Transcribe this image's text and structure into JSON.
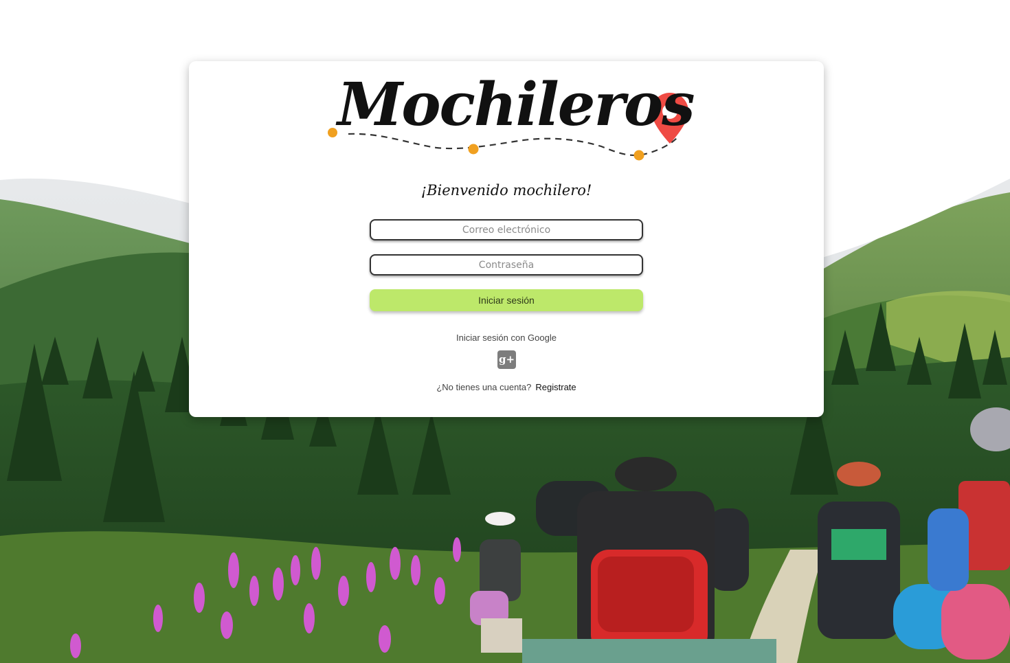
{
  "brand": {
    "name": "Mochileros",
    "accent_color": "#f0a020",
    "pin_color": "#ef4b44"
  },
  "welcome_text": "¡Bienvenido mochilero!",
  "form": {
    "email_placeholder": "Correo electrónico",
    "password_placeholder": "Contraseña",
    "login_button": "Iniciar sesión",
    "login_button_color": "#bde86a"
  },
  "google": {
    "label": "Iniciar sesión con Google",
    "icon": "google-plus-icon",
    "icon_glyph": "g+"
  },
  "signup": {
    "prompt": "¿No tienes una cuenta?",
    "link": "Registrate"
  }
}
